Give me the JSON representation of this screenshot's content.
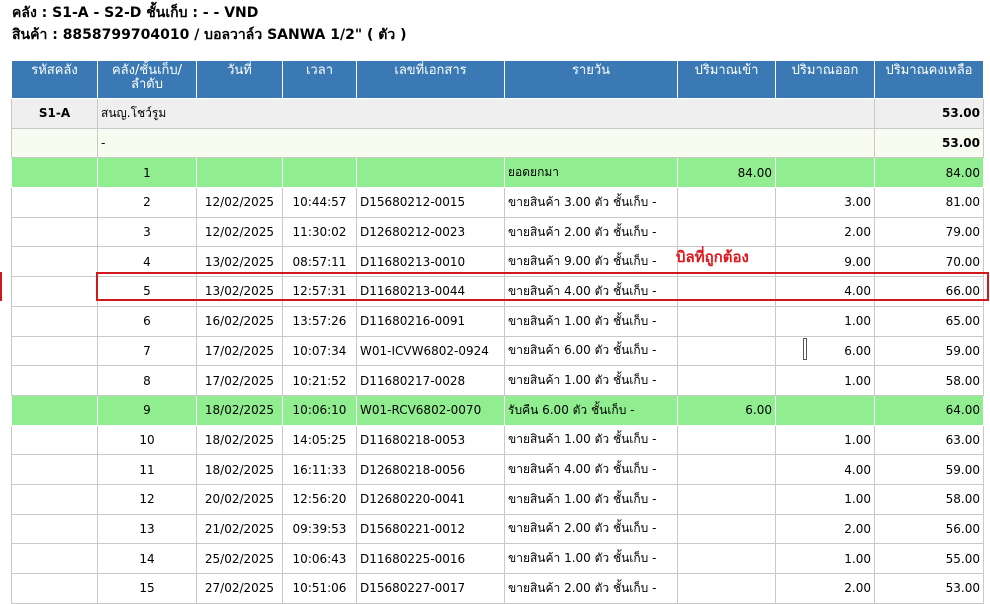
{
  "header": {
    "line1": "คลัง  :  S1-A - S2-D  ชั้นเก็บ  :  - - VND",
    "line2": "สินค้า  :  8858799704010 / บอลวาล์ว SANWA 1/2\" ( ตัว )"
  },
  "columns": [
    "รหัสคลัง",
    "คลัง/ชั้นเก็บ/\nลำดับ",
    "วันที่",
    "เวลา",
    "เลขที่เอกสาร",
    "รายวัน",
    "ปริมาณเข้า",
    "ปริมาณออก",
    "ปริมาณคงเหลือ"
  ],
  "group": {
    "code": "S1-A",
    "name": "สนญ.โชว์รูม",
    "balance": "53.00"
  },
  "subgroup": {
    "label": "-",
    "balance": "53.00"
  },
  "rows": [
    {
      "seq": "1",
      "date": "",
      "time": "",
      "doc": "",
      "desc": "ยอดยกมา",
      "in": "84.00",
      "out": "",
      "bal": "84.00",
      "style": "green"
    },
    {
      "seq": "2",
      "date": "12/02/2025",
      "time": "10:44:57",
      "doc": "D15680212-0015",
      "desc": "ขายสินค้า 3.00 ตัว ชั้นเก็บ -",
      "in": "",
      "out": "3.00",
      "bal": "81.00",
      "style": "plain"
    },
    {
      "seq": "3",
      "date": "12/02/2025",
      "time": "11:30:02",
      "doc": "D12680212-0023",
      "desc": "ขายสินค้า 2.00 ตัว ชั้นเก็บ -",
      "in": "",
      "out": "2.00",
      "bal": "79.00",
      "style": "plain"
    },
    {
      "seq": "4",
      "date": "13/02/2025",
      "time": "08:57:11",
      "doc": "D11680213-0010",
      "desc": "ขายสินค้า 9.00 ตัว ชั้นเก็บ -",
      "in": "",
      "out": "9.00",
      "bal": "70.00",
      "style": "plain"
    },
    {
      "seq": "5",
      "date": "13/02/2025",
      "time": "12:57:31",
      "doc": "D11680213-0044",
      "desc": "ขายสินค้า 4.00 ตัว ชั้นเก็บ -",
      "in": "",
      "out": "4.00",
      "bal": "66.00",
      "style": "plain"
    },
    {
      "seq": "6",
      "date": "16/02/2025",
      "time": "13:57:26",
      "doc": "D11680216-0091",
      "desc": "ขายสินค้า 1.00 ตัว ชั้นเก็บ -",
      "in": "",
      "out": "1.00",
      "bal": "65.00",
      "style": "plain"
    },
    {
      "seq": "7",
      "date": "17/02/2025",
      "time": "10:07:34",
      "doc": "W01-ICVW6802-0924",
      "desc": "ขายสินค้า 6.00 ตัว ชั้นเก็บ -",
      "in": "",
      "out": "6.00",
      "bal": "59.00",
      "style": "plain"
    },
    {
      "seq": "8",
      "date": "17/02/2025",
      "time": "10:21:52",
      "doc": "D11680217-0028",
      "desc": "ขายสินค้า 1.00 ตัว ชั้นเก็บ -",
      "in": "",
      "out": "1.00",
      "bal": "58.00",
      "style": "plain"
    },
    {
      "seq": "9",
      "date": "18/02/2025",
      "time": "10:06:10",
      "doc": "W01-RCV6802-0070",
      "desc": "รับคืน 6.00 ตัว ชั้นเก็บ -",
      "in": "6.00",
      "out": "",
      "bal": "64.00",
      "style": "green"
    },
    {
      "seq": "10",
      "date": "18/02/2025",
      "time": "14:05:25",
      "doc": "D11680218-0053",
      "desc": "ขายสินค้า 1.00 ตัว ชั้นเก็บ -",
      "in": "",
      "out": "1.00",
      "bal": "63.00",
      "style": "plain"
    },
    {
      "seq": "11",
      "date": "18/02/2025",
      "time": "16:11:33",
      "doc": "D12680218-0056",
      "desc": "ขายสินค้า 4.00 ตัว ชั้นเก็บ -",
      "in": "",
      "out": "4.00",
      "bal": "59.00",
      "style": "plain"
    },
    {
      "seq": "12",
      "date": "20/02/2025",
      "time": "12:56:20",
      "doc": "D12680220-0041",
      "desc": "ขายสินค้า 1.00 ตัว ชั้นเก็บ -",
      "in": "",
      "out": "1.00",
      "bal": "58.00",
      "style": "plain"
    },
    {
      "seq": "13",
      "date": "21/02/2025",
      "time": "09:39:53",
      "doc": "D15680221-0012",
      "desc": "ขายสินค้า 2.00 ตัว ชั้นเก็บ -",
      "in": "",
      "out": "2.00",
      "bal": "56.00",
      "style": "plain"
    },
    {
      "seq": "14",
      "date": "25/02/2025",
      "time": "10:06:43",
      "doc": "D11680225-0016",
      "desc": "ขายสินค้า 1.00 ตัว ชั้นเก็บ -",
      "in": "",
      "out": "1.00",
      "bal": "55.00",
      "style": "plain"
    },
    {
      "seq": "15",
      "date": "27/02/2025",
      "time": "10:51:06",
      "doc": "D15680227-0017",
      "desc": "ขายสินค้า 2.00 ตัว ชั้นเก็บ -",
      "in": "",
      "out": "2.00",
      "bal": "53.00",
      "style": "plain"
    }
  ],
  "annotation": {
    "text": "บิลที่ถูกต้อง",
    "color": "#e0161d",
    "highlight_row_seq": "5"
  },
  "colors": {
    "header_bg": "#3a79b3",
    "green_row": "#90ee90",
    "highlight": "#d0191f"
  }
}
